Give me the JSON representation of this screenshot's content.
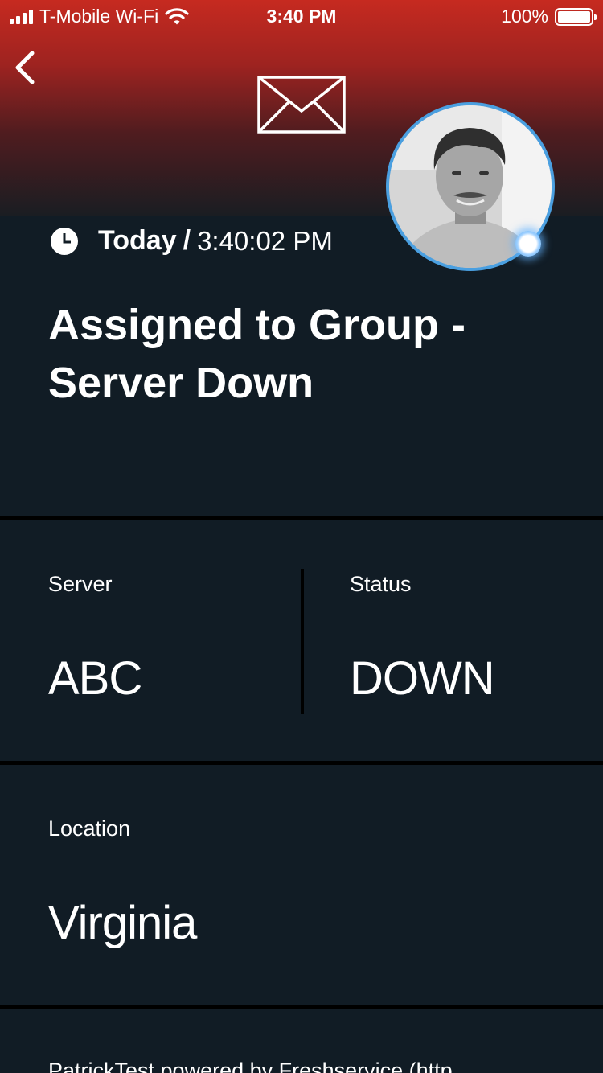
{
  "status_bar": {
    "carrier": "T-Mobile Wi-Fi",
    "time": "3:40 PM",
    "battery": "100%"
  },
  "header": {
    "back_icon": "chevron-left-icon",
    "mail_icon": "envelope-icon",
    "avatar": "user-avatar-photo",
    "presence_color": "#4aa3f0"
  },
  "message": {
    "time_day": "Today",
    "time_separator": "/",
    "time_value": "3:40:02 PM",
    "title_line1": "Assigned to Group -",
    "title_line2": "Server Down"
  },
  "fields": {
    "server_label": "Server",
    "server_value": "ABC",
    "status_label": "Status",
    "status_value": "DOWN",
    "location_label": "Location",
    "location_value": "Virginia"
  },
  "footer": {
    "text": "PatrickTest powered by Freshservice (http"
  },
  "colors": {
    "header_top": "#c62a20",
    "background": "#111c25",
    "avatar_border": "#4a9fe0"
  }
}
